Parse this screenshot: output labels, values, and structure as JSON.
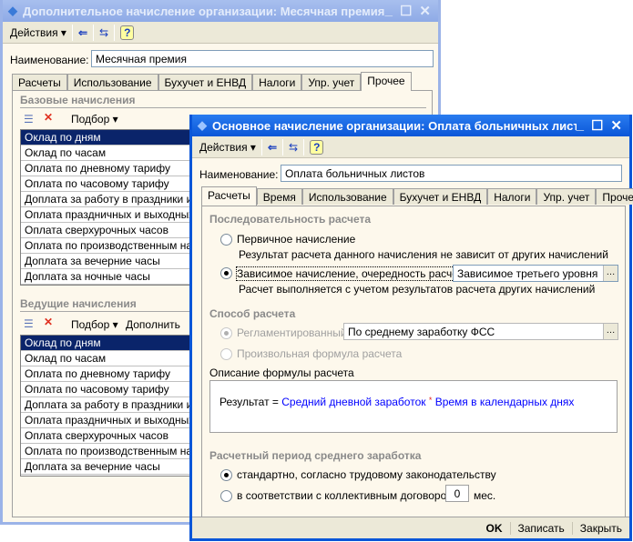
{
  "back_window": {
    "title": "Дополнительное начисление организации: Месячная премия",
    "toolbar": {
      "actions": "Действия"
    },
    "name_label": "Наименование:",
    "name_value": "Месячная премия",
    "tabs": [
      "Расчеты",
      "Использование",
      "Бухучет и ЕНВД",
      "Налоги",
      "Упр. учет",
      "Прочее"
    ],
    "selected_tab": "Прочее",
    "base": {
      "header": "Базовые начисления",
      "pick": "Подбор",
      "items": [
        "Оклад по дням",
        "Оклад по часам",
        "Оплата по дневному тарифу",
        "Оплата по часовому тарифу",
        "Доплата за работу в праздники и выходные дни",
        "Оплата праздничных и выходных дней",
        "Оплата сверхурочных часов",
        "Оплата по производственным нарядам",
        "Доплата за вечерние часы",
        "Доплата за ночные часы"
      ]
    },
    "leading": {
      "header": "Ведущие начисления",
      "pick": "Подбор",
      "fill": "Дополнить",
      "items": [
        "Оклад по дням",
        "Оклад по часам",
        "Оплата по дневному тарифу",
        "Оплата по часовому тарифу",
        "Доплата за работу в праздники и выходные дни",
        "Оплата праздничных и выходных дней",
        "Оплата сверхурочных часов",
        "Оплата по производственным нарядам",
        "Доплата за вечерние часы"
      ]
    }
  },
  "front_window": {
    "title": "Основное начисление организации: Оплата больничных листов",
    "toolbar": {
      "actions": "Действия"
    },
    "name_label": "Наименование:",
    "name_value": "Оплата больничных листов",
    "tabs": [
      "Расчеты",
      "Время",
      "Использование",
      "Бухучет и ЕНВД",
      "Налоги",
      "Упр. учет",
      "Прочее"
    ],
    "selected_tab": "Расчеты",
    "sequence": {
      "header": "Последовательность расчета",
      "primary": "Первичное начисление",
      "primary_hint": "Результат расчета данного начисления не зависит от других начислений",
      "dependent": "Зависимое начисление, очередность расчета:",
      "dependent_value": "Зависимое третьего уровня",
      "dependent_hint": "Расчет выполняется с учетом результатов расчета других начислений",
      "selected": "dependent"
    },
    "method": {
      "header": "Способ расчета",
      "regulated": "Регламентированный:",
      "regulated_value": "По среднему заработку ФСС",
      "custom": "Произвольная формула расчета",
      "selected": "regulated",
      "disabled": true
    },
    "formula": {
      "label": "Описание формулы расчета",
      "result": "Результат =",
      "operand1": "Средний дневной заработок",
      "operator": "*",
      "operand2": "Время в календарных днях"
    },
    "period": {
      "header": "Расчетный период среднего заработка",
      "standard": "стандартно, согласно трудовому законодательству",
      "contract": "в соответствии с коллективным договором:",
      "months": "0",
      "months_unit": "мес.",
      "selected": "standard"
    },
    "footer": {
      "ok": "OK",
      "save": "Записать",
      "close": "Закрыть"
    }
  },
  "colors": {
    "active_title": "#0a56d8",
    "inactive_title": "#9bb3e8",
    "selection": "#0a246a",
    "formula_link": "#0000ff"
  }
}
